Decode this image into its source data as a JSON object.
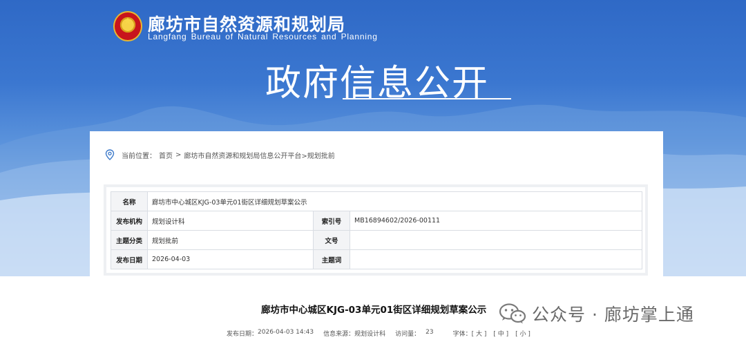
{
  "header": {
    "org_name_cn": "廊坊市自然资源和规划局",
    "org_name_en": "Langfang Bureau of Natural Resources and Planning",
    "banner_title": "政府信息公开"
  },
  "breadcrumb": {
    "prefix": "当前位置：",
    "home": "首页",
    "separator": ">",
    "path": "廊坊市自然资源和规划局信息公开平台>规划批前"
  },
  "meta": {
    "name_label": "名称",
    "name_value": "廊坊市中心城区KJG-03单元01街区详细规划草案公示",
    "publisher_label": "发布机构",
    "publisher_value": "规划设计科",
    "index_label": "索引号",
    "index_value": "MB16894602/2026-00111",
    "category_label": "主题分类",
    "category_value": "规划批前",
    "docno_label": "文号",
    "docno_value": "",
    "date_label": "发布日期",
    "date_value": "2026-04-03",
    "keywords_label": "主题词",
    "keywords_value": ""
  },
  "article": {
    "title": "廊坊市中心城区KJG-03单元01街区详细规划草案公示",
    "publish_time_label": "发布日期：",
    "publish_time": "2026-04-03 14:43",
    "source_label": "信息来源：",
    "source": "规划设计科",
    "views_label": "访问量：",
    "views": "23",
    "font_label": "字体：",
    "font_large": "[ 大 ]",
    "font_medium": "[ 中 ]",
    "font_small": "[ 小 ]"
  },
  "watermark": {
    "text": "公众号 · 廊坊掌上通"
  },
  "colors": {
    "banner_blue": "#3b77d0",
    "emblem_red": "#c8141c",
    "emblem_gold": "#e8b830"
  }
}
